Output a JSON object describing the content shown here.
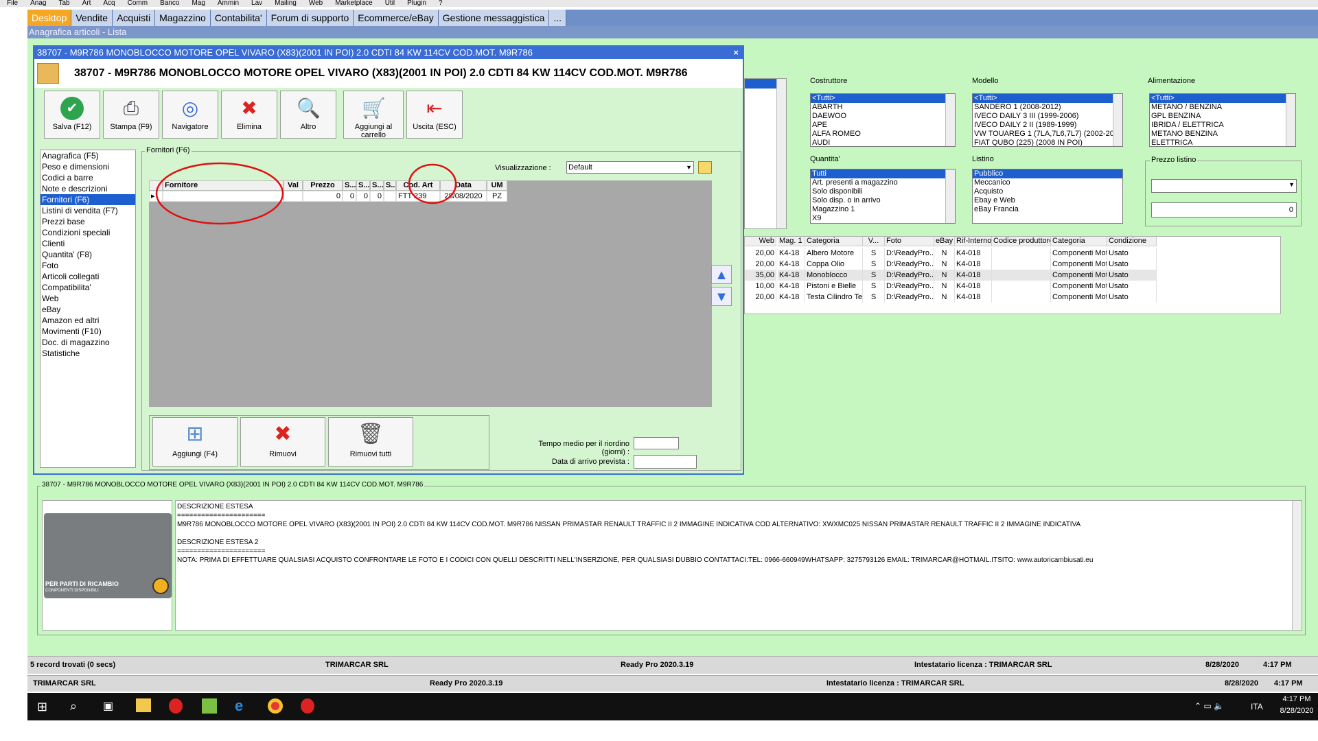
{
  "menu": [
    "File",
    "Anag",
    "Tab",
    "Art",
    "Acq",
    "Comm",
    "Banco",
    "Mag",
    "Ammin",
    "Lav",
    "Mailing",
    "Web",
    "Marketplace",
    "Util",
    "Plugin",
    "?"
  ],
  "tabs": [
    "Desktop",
    "Vendite",
    "Acquisti",
    "Magazzino",
    "Contabilita'",
    "Forum di supporto",
    "Ecommerce/eBay",
    "Gestione messaggistica",
    "..."
  ],
  "subheader": "Anagrafica articoli  - Lista",
  "dialog": {
    "title": "38707 - M9R786 MONOBLOCCO MOTORE OPEL VIVARO (X83)(2001 IN POI) 2.0 CDTI 84 KW 114CV COD.MOT. M9R786",
    "heading": "38707 - M9R786 MONOBLOCCO MOTORE OPEL VIVARO (X83)(2001 IN POI) 2.0 CDTI 84 KW 114CV COD.MOT. M9R786",
    "close": "×",
    "toolbar": [
      {
        "label": "Salva (F12)",
        "icon": "check-icon"
      },
      {
        "label": "Stampa (F9)",
        "icon": "printer-icon"
      },
      {
        "label": "Navigatore",
        "icon": "compass-icon"
      },
      {
        "label": "Elimina",
        "icon": "delete-x-icon"
      },
      {
        "label": "Altro",
        "icon": "magnifier-icon"
      },
      {
        "label": "Aggiungi al carrello",
        "icon": "cart-icon"
      },
      {
        "label": "Uscita (ESC)",
        "icon": "exit-icon"
      }
    ],
    "nav": [
      "Anagrafica (F5)",
      "Peso e dimensioni",
      "Codici a barre",
      "Note e descrizioni",
      "Fornitori (F6)",
      "Listini di vendita (F7)",
      "Prezzi base",
      "Condizioni speciali",
      "Clienti",
      "Quantita' (F8)",
      "Foto",
      "Articoli collegati",
      "Compatibilita'",
      "Web",
      "eBay",
      "Amazon ed altri",
      "Movimenti (F10)",
      "Doc. di magazzino",
      "Statistiche"
    ],
    "nav_selected": 4,
    "fornitori_group": "Fornitori (F6)",
    "visualizzazione_label": "Visualizzazione :",
    "visualizzazione_value": "Default",
    "grid_headers": [
      "Fornitore",
      "Val",
      "Prezzo",
      "S...",
      "S...",
      "S...",
      "S...",
      "Cod. Art",
      "Data",
      "UM"
    ],
    "grid_row": [
      "",
      "",
      "0",
      "0",
      "0",
      "0",
      "",
      "FTT 239",
      "28/08/2020",
      "PZ"
    ],
    "bottom_buttons": [
      "Aggiungi (F4)",
      "Rimuovi",
      "Rimuovi tutti"
    ],
    "tempo_label": "Tempo medio per il riordino (giorni) :",
    "data_label": "Data di arrivo prevista :"
  },
  "filters": {
    "costruttore": {
      "title": "Costruttore",
      "items": [
        "<Tutti>",
        "ABARTH",
        "DAEWOO",
        "APE",
        "ALFA ROMEO",
        "AUDI"
      ]
    },
    "modello": {
      "title": "Modello",
      "items": [
        "<Tutti>",
        "SANDERO 1 (2008-2012)",
        "IVECO DAILY 3 III (1999-2006)",
        "IVECO DAILY 2 II (1989-1999)",
        "VW TOUAREG 1 (7LA,7L6,7L7) (2002-2010)",
        "FIAT QUBO (225) (2008 IN POI)"
      ]
    },
    "alimentazione": {
      "title": "Alimentazione",
      "items": [
        "<Tutti>",
        "METANO / BENZINA",
        "GPL BENZINA",
        "IBRIDA / ELETTRICA",
        "METANO BENZINA",
        "ELETTRICA"
      ]
    },
    "quantita": {
      "title": "Quantita'",
      "items": [
        "Tutti",
        "Art. presenti a magazzino",
        "Solo disponibili",
        "Solo disp. o in arrivo",
        "Magazzino 1",
        "X9"
      ]
    },
    "listino": {
      "title": "Listino",
      "items": [
        "Pubblico",
        "Meccanico",
        "Acquisto",
        "Ebay e Web",
        "eBay Francia"
      ]
    },
    "prezzo": {
      "title": "Prezzo listino",
      "value": "0"
    }
  },
  "list": {
    "headers": [
      "Web",
      "Mag. 1",
      "Categoria",
      "V...",
      "Foto",
      "eBay",
      "Rif-Interno",
      "Codice produttore",
      "Categoria",
      "Condizione"
    ],
    "rows": [
      [
        "20,00",
        "K4-18",
        "Albero Motore",
        "S",
        "D:\\ReadyPro...",
        "N",
        "K4-018",
        "",
        "Componenti Mot...",
        "Usato"
      ],
      [
        "20,00",
        "K4-18",
        "Coppa Olio",
        "S",
        "D:\\ReadyPro...",
        "N",
        "K4-018",
        "",
        "Componenti Mot...",
        "Usato"
      ],
      [
        "35,00",
        "K4-18",
        "Monoblocco",
        "S",
        "D:\\ReadyPro...",
        "N",
        "K4-018",
        "",
        "Componenti Mot...",
        "Usato"
      ],
      [
        "10,00",
        "K4-18",
        "Pistoni e Bielle",
        "S",
        "D:\\ReadyPro...",
        "N",
        "K4-018",
        "",
        "Componenti Mot...",
        "Usato"
      ],
      [
        "20,00",
        "K4-18",
        "Testa Cilindro Te...",
        "S",
        "D:\\ReadyPro...",
        "N",
        "K4-018",
        "",
        "Componenti Mot...",
        "Usato"
      ]
    ]
  },
  "detail": {
    "title": "38707 - M9R786 MONOBLOCCO MOTORE OPEL VIVARO (X83)(2001 IN POI) 2.0 CDTI 84 KW 114CV COD.MOT. M9R786",
    "photo_caption": "PER PARTI DI RICAMBIO",
    "photo_sub": "COMPONENTI DISPONIBILI",
    "lines": [
      "DESCRIZIONE ESTESA",
      "======================",
      "M9R786 MONOBLOCCO MOTORE OPEL VIVARO (X83)(2001 IN POI) 2.0 CDTI 84 KW 114CV COD.MOT. M9R786 NISSAN PRIMASTAR RENAULT TRAFFIC II 2 IMMAGINE INDICATIVA COD ALTERNATIVO: XWXMC025  NISSAN PRIMASTAR RENAULT TRAFFIC II 2 IMMAGINE INDICATIVA",
      "",
      "DESCRIZIONE ESTESA 2",
      "======================",
      "NOTA: PRIMA DI EFFETTUARE QUALSIASI ACQUISTO CONFRONTARE LE FOTO E I CODICI CON QUELLI DESCRITTI NELL'INSERZIONE, PER QUALSIASI DUBBIO CONTATTACI:TEL: 0966-660949WHATSAPP: 3275793126     EMAIL: TRIMARCAR@HOTMAIL.ITSITO:  www.autoricambiusati.eu"
    ]
  },
  "status1": [
    "5 record trovati (0 secs)",
    "TRIMARCAR SRL",
    "Ready Pro 2020.3.19",
    "Intestatario licenza : TRIMARCAR SRL",
    "8/28/2020",
    "4:17 PM"
  ],
  "status2": [
    "TRIMARCAR SRL",
    "Ready Pro 2020.3.19",
    "Intestatario licenza : TRIMARCAR SRL",
    "8/28/2020",
    "4:17 PM"
  ],
  "taskbar": {
    "lang": "ITA",
    "time": "4:17 PM",
    "date": "8/28/2020"
  }
}
